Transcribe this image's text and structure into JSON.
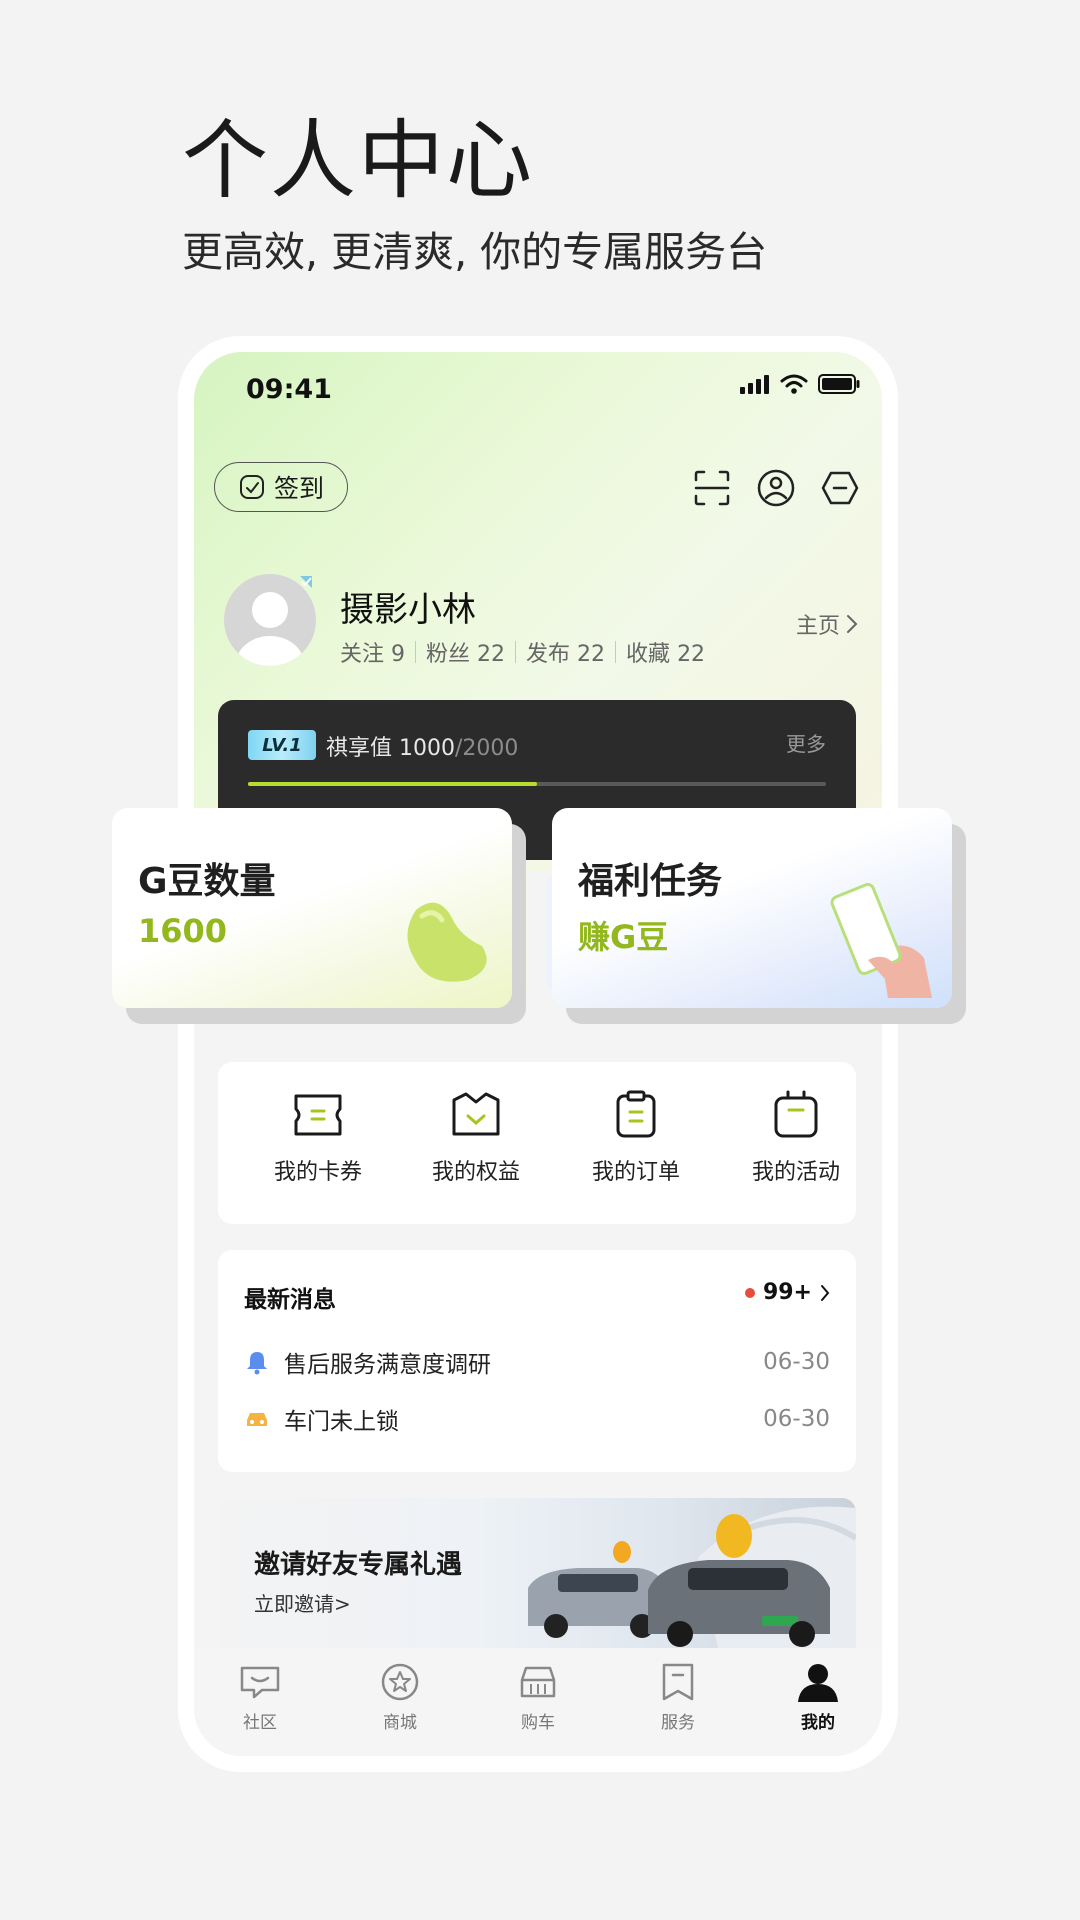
{
  "hero": {
    "title": "个人中心",
    "subtitle": "更高效, 更清爽, 你的专属服务台"
  },
  "status_bar": {
    "time": "09:41"
  },
  "header": {
    "checkin_label": "签到"
  },
  "profile": {
    "username": "摄影小林",
    "stats": [
      {
        "label": "关注",
        "value": "9"
      },
      {
        "label": "粉丝",
        "value": "22"
      },
      {
        "label": "发布",
        "value": "22"
      },
      {
        "label": "收藏",
        "value": "22"
      }
    ],
    "homepage_label": "主页"
  },
  "level": {
    "badge": "LV.1",
    "label": "祺享值",
    "current": "1000",
    "max": "/2000",
    "more_label": "更多",
    "progress": 0.5,
    "accent": "#b6dd2f"
  },
  "cards": {
    "beans": {
      "title": "G豆数量",
      "value": "1600"
    },
    "tasks": {
      "title": "福利任务",
      "value": "赚G豆"
    },
    "accent": "#93b81d"
  },
  "quick_actions": [
    {
      "label": "我的卡券",
      "icon": "coupon-icon"
    },
    {
      "label": "我的权益",
      "icon": "benefits-icon"
    },
    {
      "label": "我的订单",
      "icon": "orders-icon"
    },
    {
      "label": "我的活动",
      "icon": "activities-icon"
    }
  ],
  "messages": {
    "title": "最新消息",
    "count": "99+",
    "items": [
      {
        "text": "售后服务满意度调研",
        "date": "06-30",
        "icon": "bell-icon"
      },
      {
        "text": "车门未上锁",
        "date": "06-30",
        "icon": "car-icon"
      }
    ]
  },
  "banner": {
    "title": "邀请好友专属礼遇",
    "cta": "立即邀请>"
  },
  "tabbar": [
    {
      "label": "社区",
      "icon": "community-icon",
      "active": false
    },
    {
      "label": "商城",
      "icon": "mall-icon",
      "active": false
    },
    {
      "label": "购车",
      "icon": "buy-car-icon",
      "active": false
    },
    {
      "label": "服务",
      "icon": "service-icon",
      "active": false
    },
    {
      "label": "我的",
      "icon": "profile-icon",
      "active": true
    }
  ]
}
